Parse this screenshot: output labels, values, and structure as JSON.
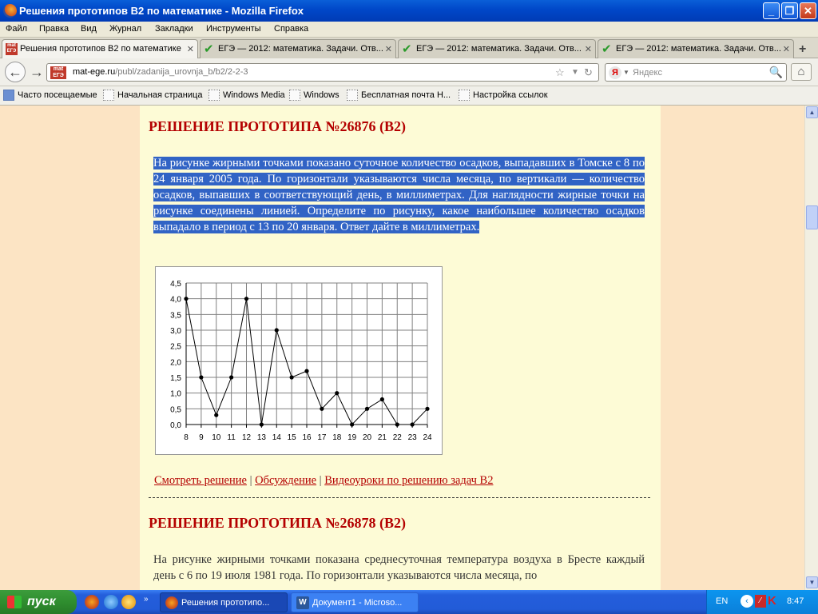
{
  "window": {
    "title": "Решения прототипов В2 по математике - Mozilla Firefox"
  },
  "menu": [
    "Файл",
    "Правка",
    "Вид",
    "Журнал",
    "Закладки",
    "Инструменты",
    "Справка"
  ],
  "tabs": [
    {
      "label": "Решения прототипов В2 по математике",
      "active": true
    },
    {
      "label": "ЕГЭ — 2012: математика. Задачи. Отв...",
      "active": false
    },
    {
      "label": "ЕГЭ — 2012: математика. Задачи. Отв...",
      "active": false
    },
    {
      "label": "ЕГЭ — 2012: математика. Задачи. Отв...",
      "active": false
    }
  ],
  "navbar": {
    "url_domain": "mat-ege.ru",
    "url_path": "/publ/zadanija_urovnja_b/b2/2-2-3",
    "search_placeholder": "Яндекс",
    "site_icon_text": "mat ЕГЭ"
  },
  "bookmarks": [
    "Часто посещаемые",
    "Начальная страница",
    "Windows Media",
    "Windows",
    "Бесплатная почта Н...",
    "Настройка ссылок"
  ],
  "content": {
    "problem1_title": "РЕШЕНИЕ ПРОТОТИПА №26876 (B2)",
    "problem1_text": "На рисунке жирными точками показано суточное количество осадков, выпадавших в Томске с 8 по 24 января 2005 года. По горизонтали указываются числа месяца, по вертикали — количество осадков, выпавших в соответствующий день, в миллиметрах. Для наглядности жирные точки на рисунке соединены линией. Определите по рисунку, какое наибольшее количество осадков выпадало в период с 13 по 20 января. Ответ дайте в миллиметрах.",
    "links": {
      "solution": "Смотреть решение",
      "sep": " | ",
      "discussion": "Обсуждение",
      "video": "Видеоуроки по решению задач B2"
    },
    "problem2_title": "РЕШЕНИЕ ПРОТОТИПА №26878 (B2)",
    "problem2_text": "На рисунке жирными точками показана среднесуточная температура воздуха в Бресте каждый день с 6 по 19 июля 1981 года. По горизонтали указываются числа месяца, по"
  },
  "chart_data": {
    "type": "line",
    "x": [
      8,
      9,
      10,
      11,
      12,
      13,
      14,
      15,
      16,
      17,
      18,
      19,
      20,
      21,
      22,
      23,
      24
    ],
    "values": [
      4.0,
      1.5,
      0.3,
      1.5,
      4.0,
      0.0,
      3.0,
      1.5,
      1.7,
      0.5,
      1.0,
      0.0,
      0.5,
      0.8,
      0.0,
      0.0,
      0.5
    ],
    "ytick_labels": [
      "0,0",
      "0,5",
      "1,0",
      "1,5",
      "2,0",
      "2,5",
      "3,0",
      "3,5",
      "4,0",
      "4,5"
    ],
    "ylim": [
      0,
      4.5
    ],
    "grid": true,
    "marker": "dot",
    "line_color": "#000000"
  },
  "taskbar": {
    "start_label": "пуск",
    "buttons": [
      "Решения прототипо...",
      "Документ1 - Microso..."
    ],
    "lang": "EN",
    "clock": "8:47"
  },
  "colors": {
    "title_red": "#b40000",
    "selection": "#3163c5",
    "page_bg": "#fdfbd6",
    "side_bg": "#fce4c4"
  }
}
